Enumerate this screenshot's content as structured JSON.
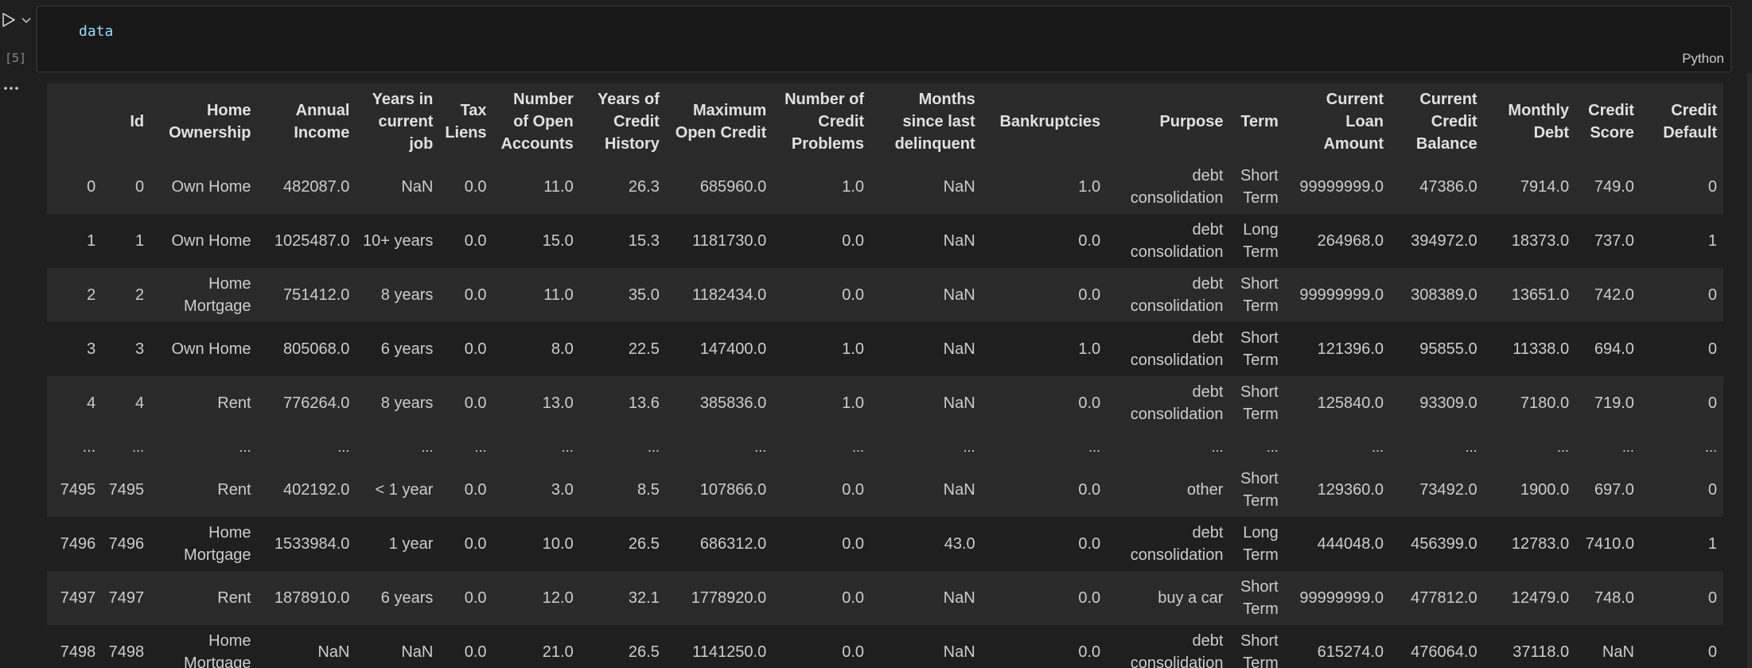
{
  "cell": {
    "exec_count": "[5]",
    "code": "data",
    "language": "Python"
  },
  "table": {
    "columns": [
      "",
      "Id",
      "Home Ownership",
      "Annual Income",
      "Years in current job",
      "Tax Liens",
      "Number of Open Accounts",
      "Years of Credit History",
      "Maximum Open Credit",
      "Number of Credit Problems",
      "Months since last delinquent",
      "Bankruptcies",
      "Purpose",
      "Term",
      "Current Loan Amount",
      "Current Credit Balance",
      "Monthly Debt",
      "Credit Score",
      "Credit Default"
    ],
    "rows": [
      [
        "0",
        "0",
        "Own Home",
        "482087.0",
        "NaN",
        "0.0",
        "11.0",
        "26.3",
        "685960.0",
        "1.0",
        "NaN",
        "1.0",
        "debt consolidation",
        "Short Term",
        "99999999.0",
        "47386.0",
        "7914.0",
        "749.0",
        "0"
      ],
      [
        "1",
        "1",
        "Own Home",
        "1025487.0",
        "10+ years",
        "0.0",
        "15.0",
        "15.3",
        "1181730.0",
        "0.0",
        "NaN",
        "0.0",
        "debt consolidation",
        "Long Term",
        "264968.0",
        "394972.0",
        "18373.0",
        "737.0",
        "1"
      ],
      [
        "2",
        "2",
        "Home Mortgage",
        "751412.0",
        "8 years",
        "0.0",
        "11.0",
        "35.0",
        "1182434.0",
        "0.0",
        "NaN",
        "0.0",
        "debt consolidation",
        "Short Term",
        "99999999.0",
        "308389.0",
        "13651.0",
        "742.0",
        "0"
      ],
      [
        "3",
        "3",
        "Own Home",
        "805068.0",
        "6 years",
        "0.0",
        "8.0",
        "22.5",
        "147400.0",
        "1.0",
        "NaN",
        "1.0",
        "debt consolidation",
        "Short Term",
        "121396.0",
        "95855.0",
        "11338.0",
        "694.0",
        "0"
      ],
      [
        "4",
        "4",
        "Rent",
        "776264.0",
        "8 years",
        "0.0",
        "13.0",
        "13.6",
        "385836.0",
        "1.0",
        "NaN",
        "0.0",
        "debt consolidation",
        "Short Term",
        "125840.0",
        "93309.0",
        "7180.0",
        "719.0",
        "0"
      ],
      [
        "...",
        "...",
        "...",
        "...",
        "...",
        "...",
        "...",
        "...",
        "...",
        "...",
        "...",
        "...",
        "...",
        "...",
        "...",
        "...",
        "...",
        "...",
        "..."
      ],
      [
        "7495",
        "7495",
        "Rent",
        "402192.0",
        "< 1 year",
        "0.0",
        "3.0",
        "8.5",
        "107866.0",
        "0.0",
        "NaN",
        "0.0",
        "other",
        "Short Term",
        "129360.0",
        "73492.0",
        "1900.0",
        "697.0",
        "0"
      ],
      [
        "7496",
        "7496",
        "Home Mortgage",
        "1533984.0",
        "1 year",
        "0.0",
        "10.0",
        "26.5",
        "686312.0",
        "0.0",
        "43.0",
        "0.0",
        "debt consolidation",
        "Long Term",
        "444048.0",
        "456399.0",
        "12783.0",
        "7410.0",
        "1"
      ],
      [
        "7497",
        "7497",
        "Rent",
        "1878910.0",
        "6 years",
        "0.0",
        "12.0",
        "32.1",
        "1778920.0",
        "0.0",
        "NaN",
        "0.0",
        "buy a car",
        "Short Term",
        "99999999.0",
        "477812.0",
        "12479.0",
        "748.0",
        "0"
      ],
      [
        "7498",
        "7498",
        "Home Mortgage",
        "NaN",
        "NaN",
        "0.0",
        "21.0",
        "26.5",
        "1141250.0",
        "0.0",
        "NaN",
        "0.0",
        "debt consolidation",
        "Short Term",
        "615274.0",
        "476064.0",
        "37118.0",
        "NaN",
        "0"
      ]
    ]
  },
  "icons": {
    "run": "play-icon",
    "run_menu": "chevron-down-icon",
    "output_menu": "ellipsis-icon"
  },
  "colors": {
    "background": "#1f1f1f",
    "cell_background": "#181818",
    "header_background": "#2a2a2a",
    "code_variable": "#9cdcfe"
  }
}
